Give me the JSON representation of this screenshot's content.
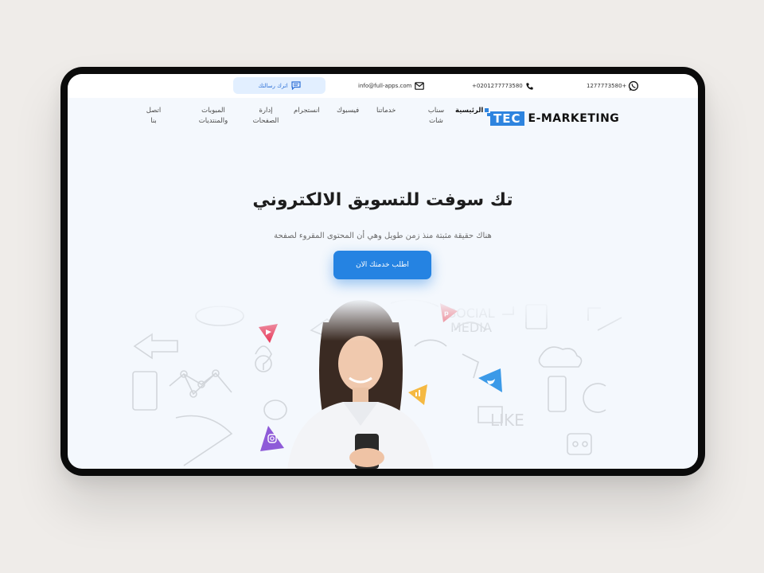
{
  "topbar": {
    "whatsapp_number": "1277773580+",
    "phone_number": "+0201277773580",
    "email": "info@full-apps.com",
    "message_button_label": "اترك رسالتك"
  },
  "brand": {
    "logo_box_text": "TEC",
    "logo_text": "E-MARKETING",
    "accent_color": "#2e84df"
  },
  "nav": {
    "items": [
      {
        "label": "الرئيسية"
      },
      {
        "label": "سناب شات"
      },
      {
        "label": "خدماتنا"
      },
      {
        "label": "فيسبوك"
      },
      {
        "label": "انستجرام"
      },
      {
        "label": "إدارة الصفحات"
      },
      {
        "label": "المبوبات والمنتديات"
      },
      {
        "label": "اتصل بنا"
      }
    ]
  },
  "hero": {
    "title": "تك سوفت للتسويق الالكتروني",
    "subtitle": "هناك حقيقة مثبتة منذ زمن طويل وهي أن المحتوى المقروء لصفحة",
    "cta_label": "اطلب خدمتك الان"
  },
  "illustration": {
    "background_text": [
      "SOCIAL MEDIA",
      "LIKE"
    ],
    "social_badges": [
      "youtube-icon",
      "pinterest-icon",
      "twitter-icon",
      "analytics-icon",
      "instagram-icon"
    ]
  }
}
